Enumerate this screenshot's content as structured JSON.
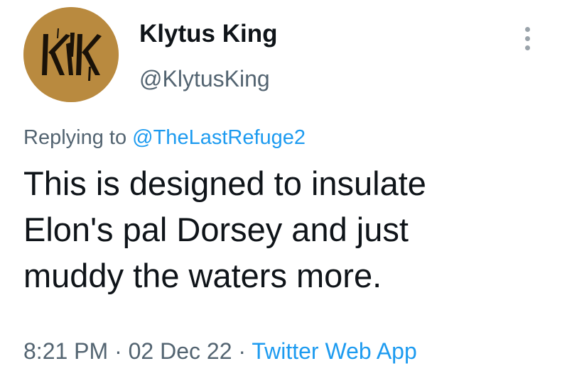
{
  "author": {
    "display_name": "Klytus King",
    "handle": "@KlytusKing",
    "avatar_monogram": "KK",
    "avatar_color": "#b98a3f"
  },
  "reply": {
    "prefix": "Replying to",
    "mention": "@TheLastRefuge2"
  },
  "tweet": {
    "lines": [
      "This is designed to insulate",
      "Elon's pal Dorsey and just",
      "muddy the waters more."
    ]
  },
  "meta": {
    "time": "8:21 PM",
    "separator": "·",
    "date": "02 Dec 22",
    "source": "Twitter Web App"
  },
  "icons": {
    "more": "more-vertical-icon"
  },
  "colors": {
    "text": "#0f1419",
    "secondary": "#536471",
    "link": "#1d9bf0"
  }
}
